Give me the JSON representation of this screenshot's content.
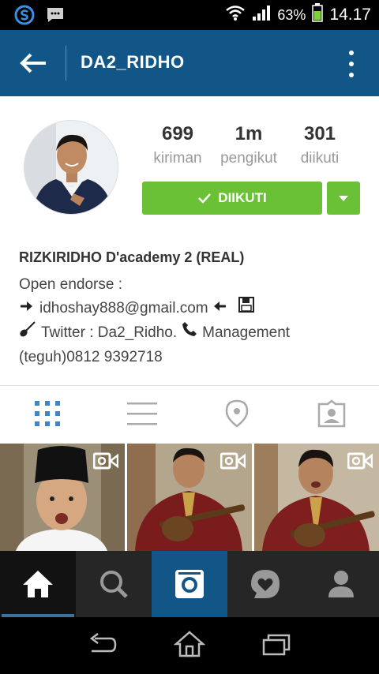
{
  "status_bar": {
    "battery_percent": "63%",
    "time": "14.17"
  },
  "header": {
    "title": "DA2_RIDHO"
  },
  "profile": {
    "stats": [
      {
        "value": "699",
        "label": "kiriman"
      },
      {
        "value": "1m",
        "label": "pengikut"
      },
      {
        "value": "301",
        "label": "diikuti"
      }
    ],
    "follow_label": "DIIKUTI",
    "name": "RIZKIRIDHO D'academy 2 (REAL)",
    "bio": {
      "line1": "Open endorse :",
      "email": "idhoshay888@gmail.com",
      "twitter": "Twitter : Da2_Ridho.",
      "management": "Management",
      "phone": "(teguh)0812 9392718"
    }
  },
  "colors": {
    "header_bg": "#125688",
    "follow_green": "#6bc135",
    "tab_active": "#3f729b"
  }
}
